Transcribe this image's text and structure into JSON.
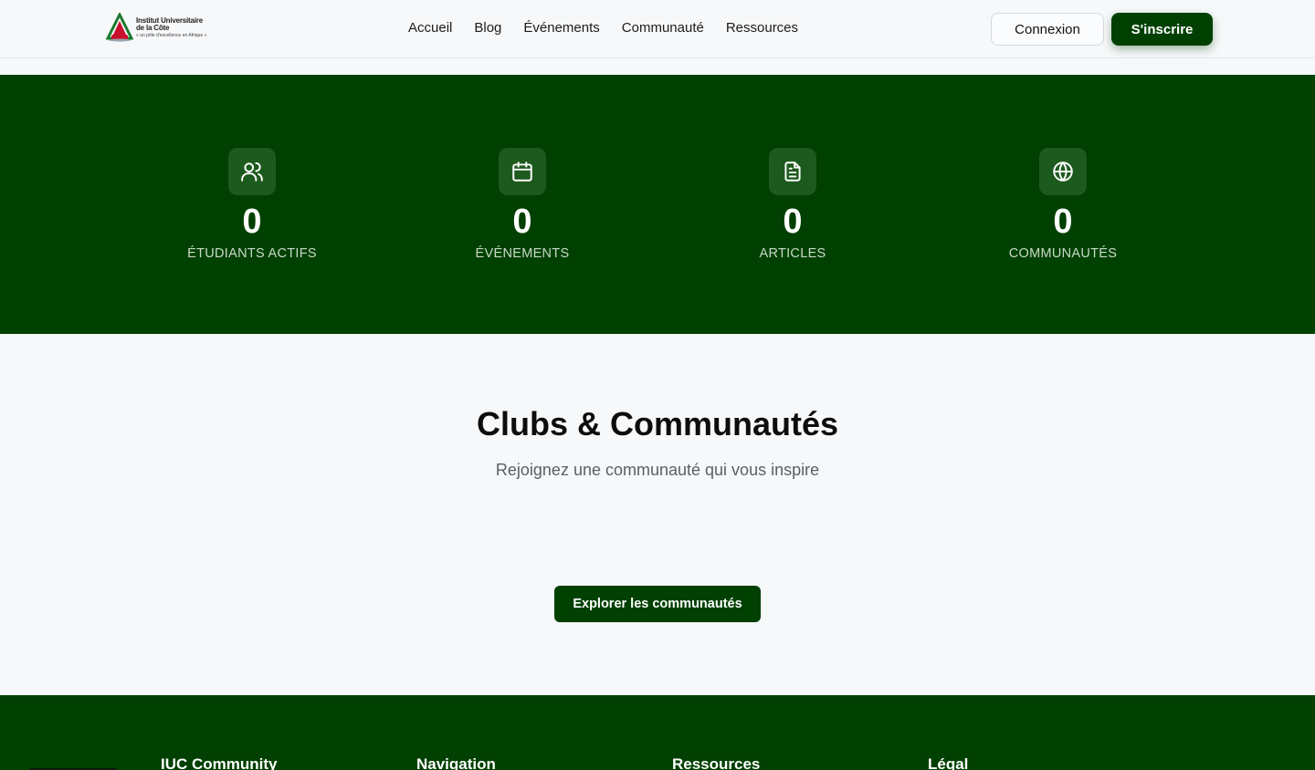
{
  "header": {
    "logo": {
      "line1": "Institut Universitaire",
      "line2": "de la Côte",
      "tagline": "« un pôle d'excellence en Afrique »"
    },
    "nav": [
      {
        "label": "Accueil"
      },
      {
        "label": "Blog"
      },
      {
        "label": "Événements"
      },
      {
        "label": "Communauté"
      },
      {
        "label": "Ressources"
      }
    ],
    "login_label": "Connexion",
    "signup_label": "S'inscrire"
  },
  "stats": [
    {
      "icon": "users-icon",
      "value": "0",
      "label": "ÉTUDIANTS ACTIFS"
    },
    {
      "icon": "calendar-icon",
      "value": "0",
      "label": "ÉVÉNEMENTS"
    },
    {
      "icon": "document-icon",
      "value": "0",
      "label": "ARTICLES"
    },
    {
      "icon": "globe-icon",
      "value": "0",
      "label": "COMMUNAUTÉS"
    }
  ],
  "clubs": {
    "title": "Clubs & Communautés",
    "subtitle": "Rejoignez une communauté qui vous inspire",
    "explore_label": "Explorer les communautés"
  },
  "footer": {
    "columns": [
      {
        "title": "IUC Community"
      },
      {
        "title": "Navigation"
      },
      {
        "title": "Ressources"
      },
      {
        "title": "Légal"
      }
    ]
  },
  "colors": {
    "brand_green": "#004000",
    "icon_tile": "#1d5a1d",
    "page_bg": "#f6f8fa"
  }
}
